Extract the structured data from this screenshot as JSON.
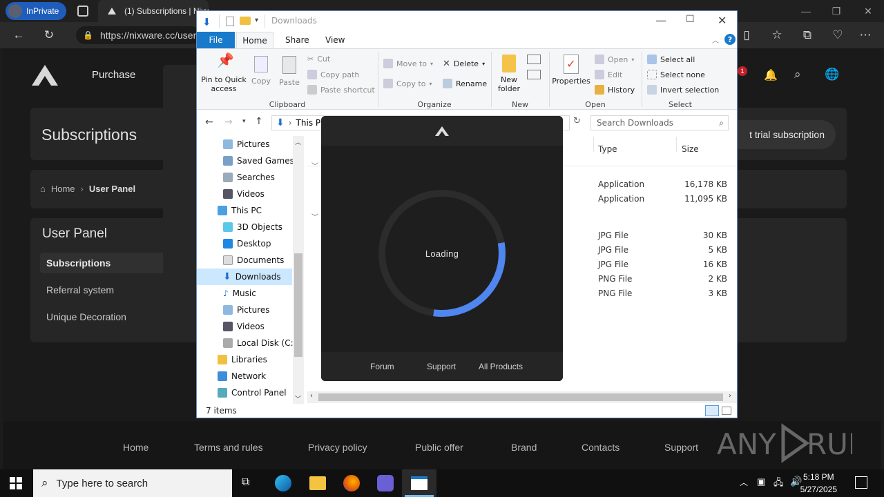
{
  "browser": {
    "inprivate_label": "InPrivate",
    "tab_title": "(1) Subscriptions | Nixware",
    "url": "https://nixware.cc/user/"
  },
  "site": {
    "nav": [
      "Purchase"
    ],
    "page_title": "Subscriptions",
    "trial_button": "t trial subscription",
    "breadcrumb_home": "Home",
    "breadcrumb_current": "User Panel",
    "panel_title": "User Panel",
    "menu": [
      "Subscriptions",
      "Referral system",
      "Unique Decoration"
    ],
    "notification_count": "1",
    "footer_links": [
      "Home",
      "Terms and rules",
      "Privacy policy",
      "Public offer",
      "Brand",
      "Contacts",
      "Support"
    ]
  },
  "explorer": {
    "title": "Downloads",
    "tabs": [
      "File",
      "Home",
      "Share",
      "View"
    ],
    "clipboard": {
      "pin": "Pin to Quick access",
      "copy": "Copy",
      "paste": "Paste",
      "cut": "Cut",
      "copy_path": "Copy path",
      "paste_shortcut": "Paste shortcut",
      "group": "Clipboard"
    },
    "organize": {
      "move_to": "Move to",
      "copy_to": "Copy to",
      "delete": "Delete",
      "rename": "Rename",
      "group": "Organize"
    },
    "new": {
      "new_folder": "New folder",
      "group": "New"
    },
    "open": {
      "properties": "Properties",
      "open": "Open",
      "edit": "Edit",
      "history": "History",
      "group": "Open"
    },
    "select": {
      "select_all": "Select all",
      "select_none": "Select none",
      "invert": "Invert selection",
      "group": "Select"
    },
    "address": "This PC",
    "search_placeholder": "Search Downloads",
    "nav_items": [
      "Pictures",
      "Saved Games",
      "Searches",
      "Videos",
      "This PC",
      "3D Objects",
      "Desktop",
      "Documents",
      "Downloads",
      "Music",
      "Pictures",
      "Videos",
      "Local Disk (C:)",
      "Libraries",
      "Network",
      "Control Panel"
    ],
    "columns": {
      "type": "Type",
      "size": "Size"
    },
    "rows": [
      {
        "type": "Application",
        "size": "16,178 KB"
      },
      {
        "type": "Application",
        "size": "11,095 KB"
      },
      {
        "type": "JPG File",
        "size": "30 KB"
      },
      {
        "type": "JPG File",
        "size": "5 KB"
      },
      {
        "type": "JPG File",
        "size": "16 KB"
      },
      {
        "type": "PNG File",
        "size": "2 KB"
      },
      {
        "type": "PNG File",
        "size": "3 KB"
      }
    ],
    "status": "7 items"
  },
  "loader": {
    "status": "Loading",
    "progress": 0.3,
    "links": [
      "Forum",
      "Support",
      "All Products"
    ]
  },
  "taskbar": {
    "search_placeholder": "Type here to search",
    "time": "5:18 PM",
    "date": "5/27/2025"
  },
  "watermark": "ANY RUN"
}
